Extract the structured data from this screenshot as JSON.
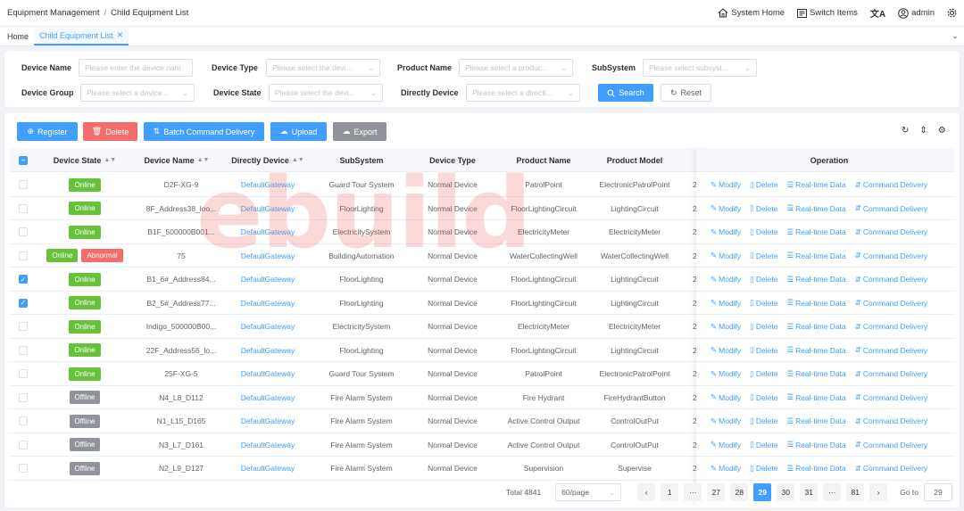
{
  "topbar": {
    "breadcrumb": [
      "Equipment Management",
      "Child Equipment List"
    ],
    "breadcrumb_sep": "/",
    "system_home": "System Home",
    "switch_items": "Switch Items",
    "user": "admin"
  },
  "tabs": [
    {
      "label": "Home",
      "active": false
    },
    {
      "label": "Child Equipment List",
      "active": true
    }
  ],
  "filters": {
    "device_name": {
      "label": "Device Name",
      "placeholder": "Please enter the device nam"
    },
    "device_type": {
      "label": "Device Type",
      "placeholder": "Please select the devi..."
    },
    "product_name": {
      "label": "Product Name",
      "placeholder": "Please select a produc..."
    },
    "subsystem": {
      "label": "SubSystem",
      "placeholder": "Please select subsyst..."
    },
    "device_group": {
      "label": "Device Group",
      "placeholder": "Please select a device..."
    },
    "device_state": {
      "label": "Device State",
      "placeholder": "Please select the devi..."
    },
    "directly_device": {
      "label": "Directly Device",
      "placeholder": "Please select a directl..."
    },
    "search_label": "Search",
    "reset_label": "Reset"
  },
  "toolbar": {
    "register": "Register",
    "delete": "Delete",
    "batch": "Batch Command Delivery",
    "upload": "Upload",
    "export": "Export"
  },
  "table": {
    "headers": [
      "Device State",
      "Device Name",
      "Directly Device",
      "SubSystem",
      "Device Type",
      "Product Name",
      "Product Model",
      "Operation"
    ],
    "ops": [
      "Modify",
      "Delete",
      "Real-time Data",
      "Command Delivery"
    ],
    "truncated_col_char": "2",
    "rows": [
      {
        "checked": false,
        "states": [
          "Online"
        ],
        "name": "D2F-XG-9",
        "gateway": "DefaultGateway",
        "subsystem": "Guard Tour System",
        "type": "Normal Device",
        "product": "PatrolPoint",
        "model": "ElectronicPatrolPoint"
      },
      {
        "checked": false,
        "states": [
          "Online"
        ],
        "name": "8F_Address38_loo...",
        "gateway": "DefaultGateway",
        "subsystem": "FloorLighting",
        "type": "Normal Device",
        "product": "FloorLightingCircuit",
        "model": "LightingCircuit"
      },
      {
        "checked": false,
        "states": [
          "Online"
        ],
        "name": "B1F_500000B001...",
        "gateway": "DefaultGateway",
        "subsystem": "ElectricitySystem",
        "type": "Normal Device",
        "product": "ElectricityMeter",
        "model": "ElectricityMeter"
      },
      {
        "checked": false,
        "states": [
          "Online",
          "Abnormal"
        ],
        "name": "75",
        "gateway": "DefaultGateway",
        "subsystem": "BuildingAutomation",
        "type": "Normal Device",
        "product": "WaterCollectingWell",
        "model": "WaterCollectingWell"
      },
      {
        "checked": true,
        "states": [
          "Online"
        ],
        "name": "B1_6#_Address84...",
        "gateway": "DefaultGateway",
        "subsystem": "FloorLighting",
        "type": "Normal Device",
        "product": "FloorLightingCircuit",
        "model": "LightingCircuit"
      },
      {
        "checked": true,
        "states": [
          "Online"
        ],
        "name": "B2_5#_Address77...",
        "gateway": "DefaultGateway",
        "subsystem": "FloorLighting",
        "type": "Normal Device",
        "product": "FloorLightingCircuit",
        "model": "LightingCircuit"
      },
      {
        "checked": false,
        "states": [
          "Online"
        ],
        "name": "Indigo_500000B00...",
        "gateway": "DefaultGateway",
        "subsystem": "ElectricitySystem",
        "type": "Normal Device",
        "product": "ElectricityMeter",
        "model": "ElectricityMeter"
      },
      {
        "checked": false,
        "states": [
          "Online"
        ],
        "name": "22F_Address56_lo...",
        "gateway": "DefaultGateway",
        "subsystem": "FloorLighting",
        "type": "Normal Device",
        "product": "FloorLightingCircuit",
        "model": "LightingCircuit"
      },
      {
        "checked": false,
        "states": [
          "Online"
        ],
        "name": "25F-XG-5",
        "gateway": "DefaultGateway",
        "subsystem": "Guard Tour System",
        "type": "Normal Device",
        "product": "PatrolPoint",
        "model": "ElectronicPatrolPoint"
      },
      {
        "checked": false,
        "states": [
          "Offline"
        ],
        "name": "N4_L8_D112",
        "gateway": "DefaultGateway",
        "subsystem": "Fire Alarm System",
        "type": "Normal Device",
        "product": "Fire Hydrant",
        "model": "FireHydrantButton"
      },
      {
        "checked": false,
        "states": [
          "Offline"
        ],
        "name": "N1_L15_D165",
        "gateway": "DefaultGateway",
        "subsystem": "Fire Alarm System",
        "type": "Normal Device",
        "product": "Active Control Output",
        "model": "ControlOutPut"
      },
      {
        "checked": false,
        "states": [
          "Offline"
        ],
        "name": "N3_L7_D161",
        "gateway": "DefaultGateway",
        "subsystem": "Fire Alarm System",
        "type": "Normal Device",
        "product": "Active Control Output",
        "model": "ControlOutPut"
      },
      {
        "checked": false,
        "states": [
          "Offline"
        ],
        "name": "N2_L9_D127",
        "gateway": "DefaultGateway",
        "subsystem": "Fire Alarm System",
        "type": "Normal Device",
        "product": "Supervision",
        "model": "Supervise"
      }
    ]
  },
  "pagination": {
    "total": "Total 4841",
    "page_size": "60/page",
    "pages": [
      "1",
      "···",
      "27",
      "28",
      "29",
      "30",
      "31",
      "···",
      "81"
    ],
    "active_page": "29",
    "goto_label": "Go to",
    "goto_value": "29"
  },
  "watermark": "ebuild",
  "colors": {
    "primary": "#409eff",
    "danger": "#f56c6c",
    "success": "#67c23a",
    "info": "#909399"
  }
}
